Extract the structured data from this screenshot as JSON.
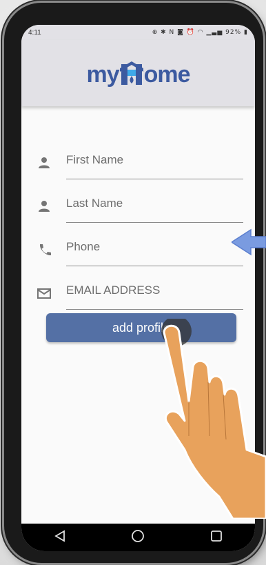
{
  "status_bar": {
    "time": "4:11",
    "indicators": "⊕ ✱ N ◙ ⏰",
    "battery": "92%"
  },
  "app": {
    "logo_prefix": "my",
    "logo_suffix": "ome",
    "brand_color": "#3c5aa0"
  },
  "form": {
    "fields": [
      {
        "placeholder": "First Name",
        "icon": "person-icon"
      },
      {
        "placeholder": "Last Name",
        "icon": "person-icon"
      },
      {
        "placeholder": "Phone",
        "icon": "phone-icon"
      },
      {
        "placeholder": "EMAIL ADDRESS",
        "icon": "mail-icon"
      }
    ],
    "submit_label": "add profile",
    "button_color": "#5470a5"
  },
  "nav": {
    "back_icon": "back-triangle-icon",
    "home_icon": "home-circle-icon",
    "recents_icon": "recents-square-icon"
  }
}
